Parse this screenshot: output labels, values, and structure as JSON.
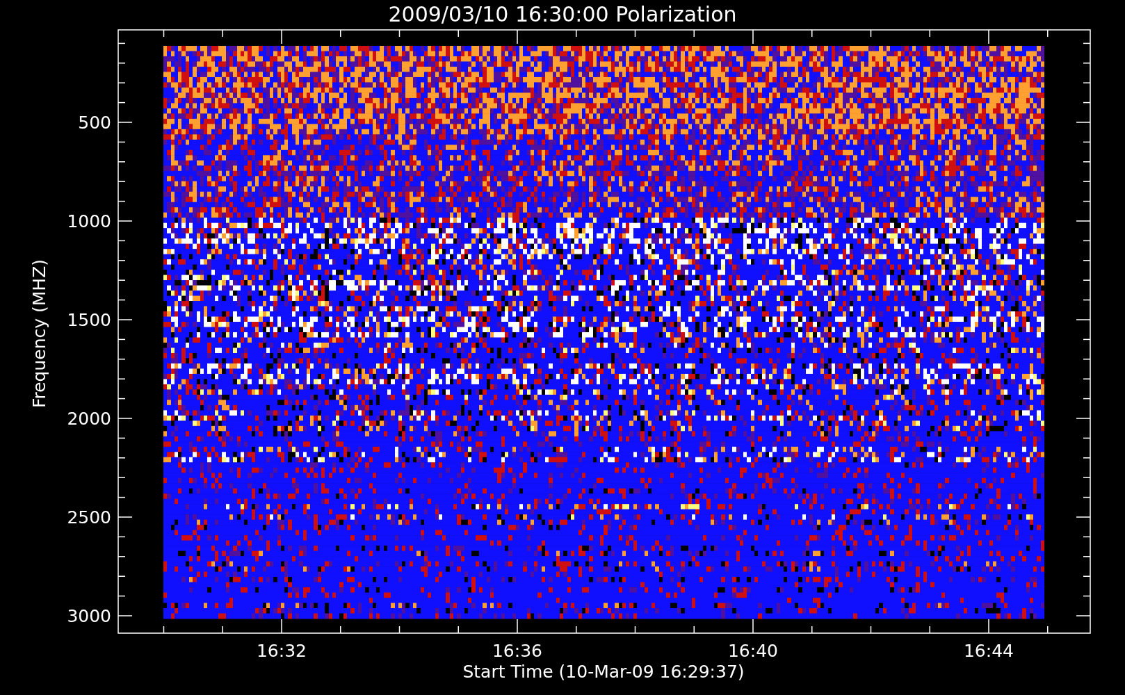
{
  "plot": {
    "title": "2009/03/10 16:30:00 Polarization",
    "y_axis": {
      "label": "Frequency (MHZ)",
      "tick_labels": [
        "500",
        "1000",
        "1500",
        "2000",
        "2500",
        "3000"
      ]
    },
    "x_axis": {
      "label": "Start Time (10-Mar-09 16:29:37)",
      "tick_labels": [
        "16:32",
        "16:36",
        "16:40",
        "16:44"
      ]
    }
  }
}
